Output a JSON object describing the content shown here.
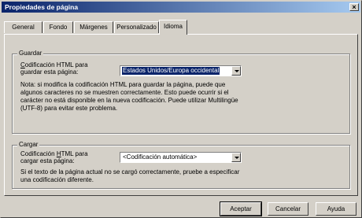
{
  "window": {
    "title": "Propiedades de página",
    "close_glyph": "×"
  },
  "tabs": [
    {
      "label": "General"
    },
    {
      "label": "Fondo"
    },
    {
      "label": "Márgenes"
    },
    {
      "label": "Personalizado"
    },
    {
      "label": "Idioma"
    }
  ],
  "active_tab": "Idioma",
  "guardar": {
    "legend": "Guardar",
    "label_line1_pre": "",
    "label_line1_mn": "C",
    "label_line1_post": "odificación HTML para",
    "label_line2": "guardar esta página:",
    "select_value": "Estados Unidos/Europa occidental",
    "note": "Nota: si modifica la codificación HTML para guardar la página, puede que algunos caracteres no se muestren correctamente. Esto puede ocurrir si el carácter no está disponible en la nueva codificación. Puede utilizar Multilingüe (UTF-8) para evitar este problema."
  },
  "cargar": {
    "legend": "Cargar",
    "label_line1_pre": "Codificación ",
    "label_line1_mn": "H",
    "label_line1_post": "TML para",
    "label_line2": "cargar esta página:",
    "select_value": "<Codificación automática>",
    "note": "Si el texto de la página actual no se cargó correctamente, pruebe a especificar una codificación diferente."
  },
  "buttons": {
    "ok": "Aceptar",
    "cancel": "Cancelar",
    "help": "Ayuda"
  }
}
